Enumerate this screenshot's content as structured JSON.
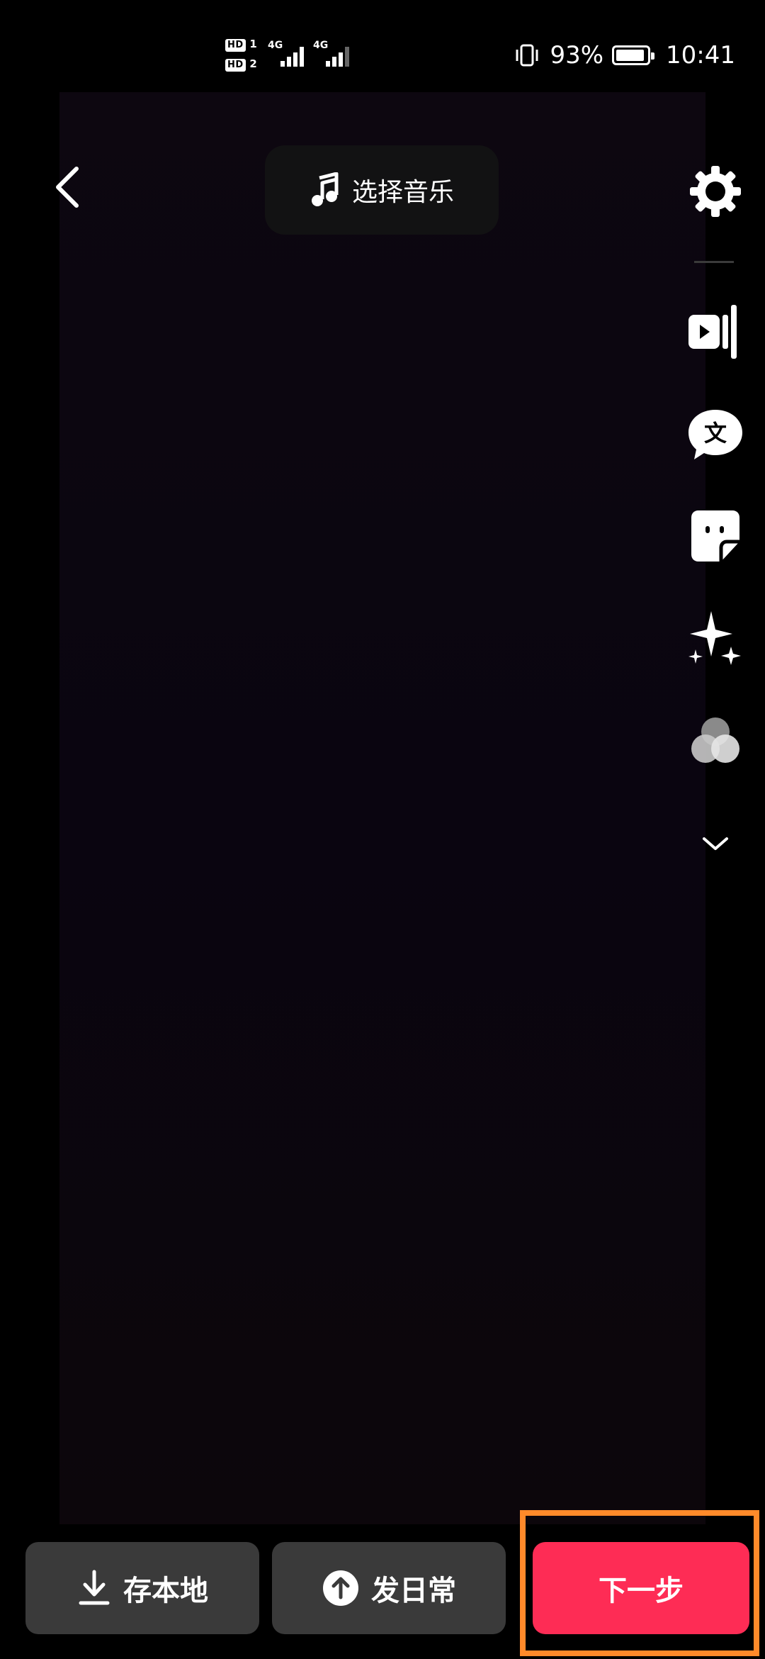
{
  "status_bar": {
    "sim1_label": "1",
    "sim2_label": "2",
    "hd_label": "HD",
    "network1": "4G",
    "network2": "4G",
    "battery_percent": "93%",
    "battery_level": 0.93,
    "time": "10:41"
  },
  "top_bar": {
    "music_label": "选择音乐"
  },
  "toolbar": {
    "items": [
      "settings-icon",
      "clip-icon",
      "text-icon",
      "sticker-icon",
      "effects-icon",
      "filter-icon",
      "more-icon"
    ]
  },
  "bottom": {
    "save_label": "存本地",
    "daily_label": "发日常",
    "next_label": "下一步"
  },
  "colors": {
    "accent": "#fe2c55",
    "secondary_button": "#3a3a3a",
    "highlight": "#ff8a2a"
  }
}
